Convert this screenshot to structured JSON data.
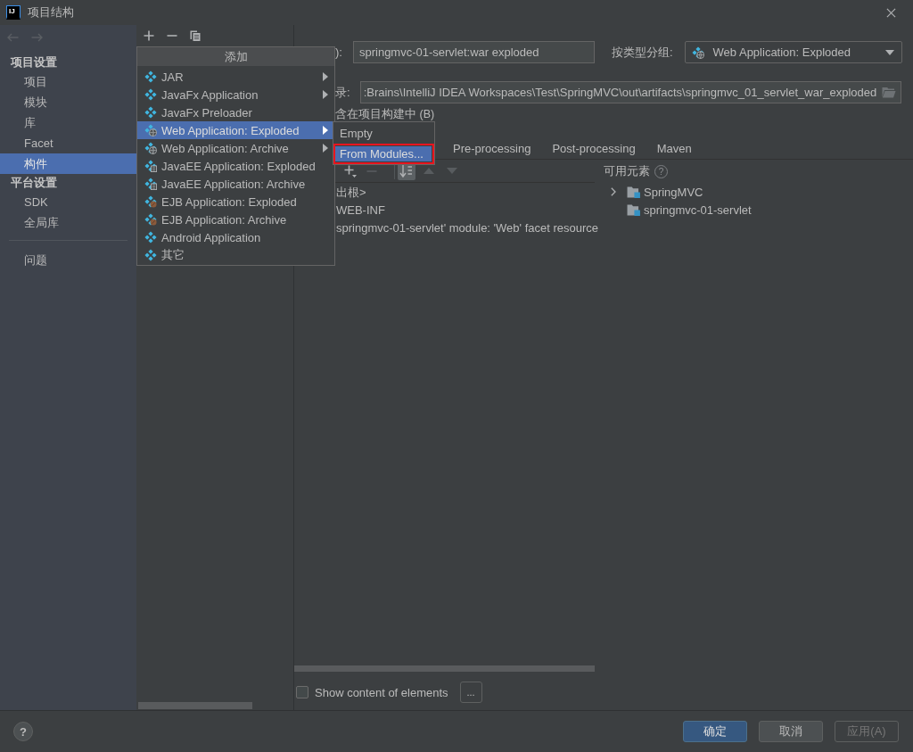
{
  "window": {
    "logo": "IJ",
    "title": "项目结构"
  },
  "sidebar": {
    "sections": [
      {
        "title": "项目设置",
        "items": [
          {
            "label": "项目",
            "selected": false
          },
          {
            "label": "模块",
            "selected": false
          },
          {
            "label": "库",
            "selected": false
          },
          {
            "label": "Facet",
            "selected": false
          },
          {
            "label": "构件",
            "selected": true
          }
        ]
      },
      {
        "title": "平台设置",
        "items": [
          {
            "label": "SDK",
            "selected": false
          },
          {
            "label": "全局库",
            "selected": false
          }
        ]
      }
    ],
    "bottom_items": [
      {
        "label": "问题",
        "selected": false
      }
    ]
  },
  "details": {
    "name_label": "):",
    "name_value": "springmvc-01-servlet:war exploded",
    "type_label": "按类型分组:",
    "type_value": "Web Application: Exploded",
    "output_label": "录:",
    "output_value": ":Brains\\IntelliJ IDEA Workspaces\\Test\\SpringMVC\\out\\artifacts\\springmvc_01_servlet_war_exploded",
    "build_option": "含在项目构建中 (B)"
  },
  "tabs": [
    {
      "label": "Pre-processing",
      "selected": false
    },
    {
      "label": "Post-processing",
      "selected": false
    },
    {
      "label": "Maven",
      "selected": false
    }
  ],
  "layout_tree": {
    "sort_selected": true,
    "items": [
      "出根>",
      "WEB-INF",
      "springmvc-01-servlet' module: 'Web' facet resource"
    ]
  },
  "available_elements": {
    "title": "可用元素",
    "help": "?",
    "items": [
      {
        "label": "SpringMVC",
        "expanded": false
      },
      {
        "label": "springmvc-01-servlet"
      }
    ]
  },
  "show_content": {
    "label": "Show content of elements",
    "checked": false
  },
  "more_button": "...",
  "footer": {
    "help": "?",
    "buttons": [
      {
        "label": "确定",
        "kind": "ok",
        "disabled": false
      },
      {
        "label": "取消",
        "kind": "cancel",
        "disabled": false
      },
      {
        "label": "应用(A)",
        "kind": "apply",
        "disabled": true
      }
    ]
  },
  "add_menu": {
    "title": "添加",
    "items": [
      {
        "label": "JAR",
        "kind": "plain",
        "has_submenu": true,
        "selected": false
      },
      {
        "label": "JavaFx Application",
        "kind": "plain",
        "has_submenu": true,
        "selected": false
      },
      {
        "label": "JavaFx Preloader",
        "kind": "plain",
        "has_submenu": false,
        "selected": false
      },
      {
        "label": "Web Application: Exploded",
        "kind": "web",
        "has_submenu": true,
        "selected": true
      },
      {
        "label": "Web Application: Archive",
        "kind": "web",
        "has_submenu": true,
        "selected": false
      },
      {
        "label": "JavaEE Application: Exploded",
        "kind": "javaee",
        "has_submenu": false,
        "selected": false
      },
      {
        "label": "JavaEE Application: Archive",
        "kind": "javaee",
        "has_submenu": false,
        "selected": false
      },
      {
        "label": "EJB Application: Exploded",
        "kind": "ejb",
        "has_submenu": false,
        "selected": false
      },
      {
        "label": "EJB Application: Archive",
        "kind": "ejb",
        "has_submenu": false,
        "selected": false
      },
      {
        "label": "Android Application",
        "kind": "plain",
        "has_submenu": false,
        "selected": false
      },
      {
        "label": "其它",
        "kind": "plain",
        "has_submenu": false,
        "selected": false
      }
    ]
  },
  "add_submenu": {
    "items": [
      {
        "label": "Empty",
        "selected": false,
        "highlighted": false
      },
      {
        "label": "From Modules...",
        "selected": true,
        "highlighted": true
      }
    ]
  }
}
